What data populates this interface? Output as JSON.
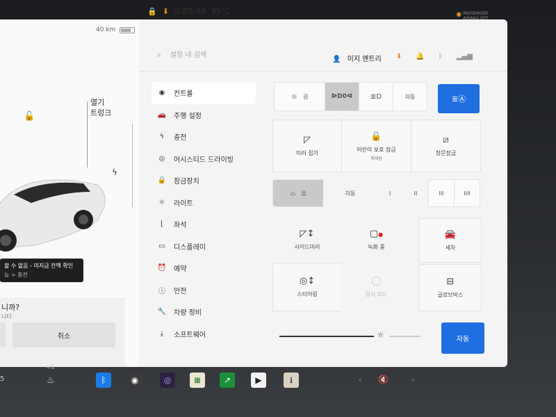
{
  "status": {
    "range": "40 km",
    "time": "오후5:03",
    "temperature": "35°C",
    "airbag": "PASSENGER AIRBAG OFF"
  },
  "left": {
    "trunk_label_1": "열기",
    "trunk_label_2": "트렁크",
    "alert_title": "할 수 없음 - 미지급 잔액 확인",
    "alert_sub": "능 > 충전",
    "dialog_question": "니까?",
    "dialog_sub": "니다",
    "cancel_label": "취소"
  },
  "search": {
    "placeholder": "설정 내 검색"
  },
  "profile": {
    "name": "이지 엔트리"
  },
  "nav": [
    {
      "label": "컨트롤",
      "icon": "toggle-icon"
    },
    {
      "label": "주행 설정",
      "icon": "car-icon"
    },
    {
      "label": "충전",
      "icon": "bolt-icon"
    },
    {
      "label": "어시스티드 드라이빙",
      "icon": "steering-wheel-icon"
    },
    {
      "label": "잠금장치",
      "icon": "lock-icon"
    },
    {
      "label": "라이트",
      "icon": "light-icon"
    },
    {
      "label": "좌석",
      "icon": "seat-icon"
    },
    {
      "label": "디스플레이",
      "icon": "display-icon"
    },
    {
      "label": "예약",
      "icon": "clock-icon"
    },
    {
      "label": "안전",
      "icon": "info-icon"
    },
    {
      "label": "차량 정비",
      "icon": "wrench-icon"
    },
    {
      "label": "소프트웨어",
      "icon": "download-icon"
    }
  ],
  "lights": {
    "off": "끔",
    "auto": "자동"
  },
  "tiles_row1": [
    {
      "label": "미러 접기",
      "sub": ""
    },
    {
      "label": "어린이 보호 잠금",
      "sub": "해제됨"
    },
    {
      "label": "창문잠금",
      "sub": ""
    }
  ],
  "wipers": {
    "off": "끔",
    "auto": "자동",
    "levels": [
      "I",
      "II",
      "III",
      "IIII"
    ]
  },
  "tiles_grid": [
    {
      "label": "사이드미러"
    },
    {
      "label": "녹화 중"
    },
    {
      "label": "세차"
    },
    {
      "label": "스티어링"
    },
    {
      "label": "감시 모드"
    },
    {
      "label": "글로브박스"
    }
  ],
  "brightness": {
    "auto_label": "자동",
    "level": 0.79
  },
  "taskbar": {
    "auto": "자동",
    "speed": "5"
  },
  "colors": {
    "accent": "#1f6fe0",
    "download": "#e8871e"
  }
}
